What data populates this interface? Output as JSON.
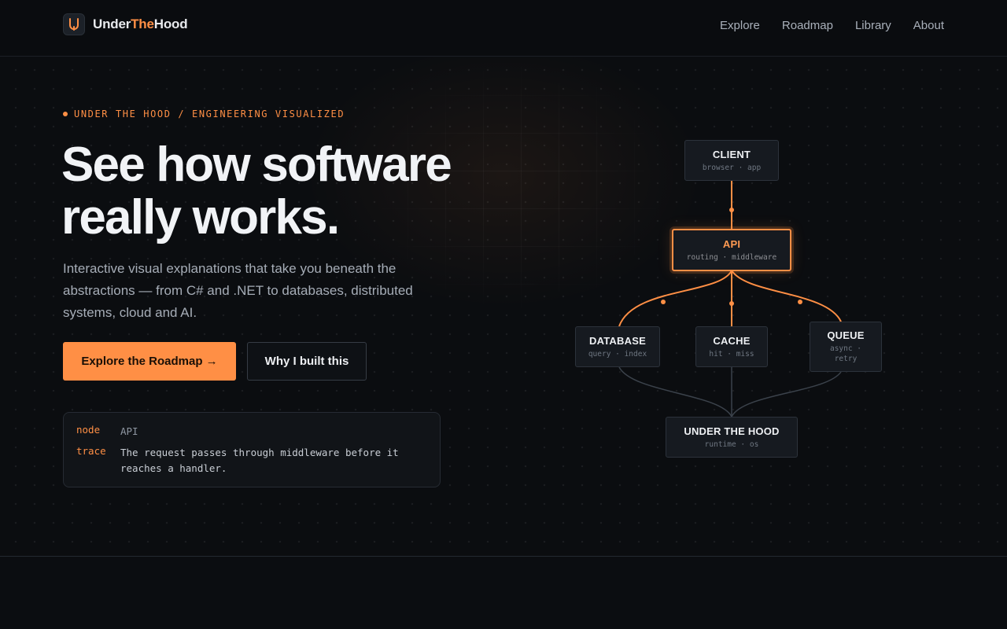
{
  "header": {
    "brand": {
      "part1": "Under",
      "part2": "The",
      "part3": "Hood"
    },
    "nav": [
      "Explore",
      "Roadmap",
      "Library",
      "About"
    ]
  },
  "hero": {
    "eyebrow": "UNDER THE HOOD / ENGINEERING VISUALIZED",
    "headline_line1": "See how software",
    "headline_line2": "really works.",
    "subtitle": "Interactive visual explanations that take you beneath the abstractions — from C# and .NET to databases, distributed systems, cloud and AI.",
    "primary_cta": "Explore the Roadmap →",
    "secondary_cta": "Why I built this",
    "trace": {
      "node_key": "node",
      "node_value": "API",
      "trace_key": "trace",
      "trace_value": "The request passes through middleware before it reaches a handler."
    }
  },
  "diagram": {
    "active_node": "API",
    "nodes": {
      "client": {
        "title": "CLIENT",
        "sub": "browser · app"
      },
      "api": {
        "title": "API",
        "sub": "routing · middleware"
      },
      "database": {
        "title": "DATABASE",
        "sub": "query · index"
      },
      "cache": {
        "title": "CACHE",
        "sub": "hit · miss"
      },
      "queue": {
        "title": "QUEUE",
        "sub": "async · retry"
      },
      "runtime": {
        "title": "UNDER THE HOOD",
        "sub": "runtime · os"
      }
    }
  },
  "colors": {
    "accent": "#ff8f45",
    "background": "#0b0d10",
    "text": "#f1f3f6",
    "muted": "#a6adb7"
  }
}
